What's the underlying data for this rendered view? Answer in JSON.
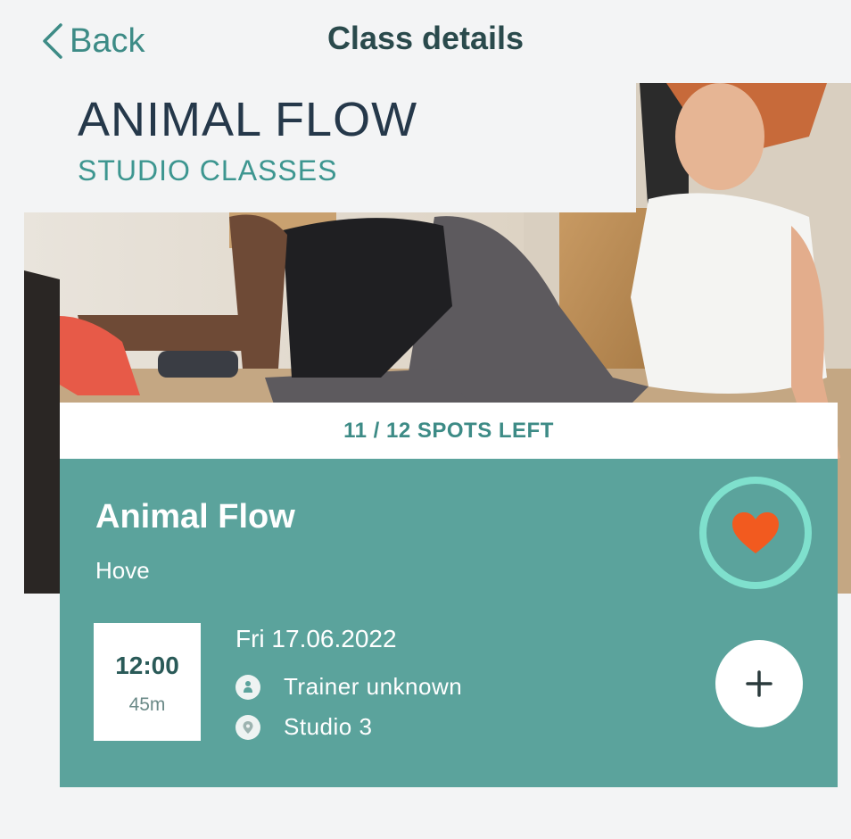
{
  "nav": {
    "back_label": "Back",
    "title": "Class details"
  },
  "hero": {
    "class_title": "ANIMAL FLOW",
    "category": "STUDIO CLASSES"
  },
  "card": {
    "spots": "11 / 12 SPOTS LEFT",
    "name": "Animal Flow",
    "location": "Hove",
    "time_start": "12:00",
    "duration": "45m",
    "date": "Fri 17.06.2022",
    "trainer": "Trainer unknown",
    "studio": "Studio 3",
    "favorite": true
  },
  "icons": {
    "back": "chevron-left-icon",
    "favorite": "heart-icon",
    "trainer": "trainer-icon",
    "studio": "location-pin-icon",
    "add": "plus-icon"
  },
  "colors": {
    "accent": "#3d8b86",
    "card_bg": "#5ba39c",
    "favorite_ring": "#7fe0cd",
    "heart": "#f25a1f",
    "title_dark": "#25384a",
    "background": "#f3f4f5"
  }
}
